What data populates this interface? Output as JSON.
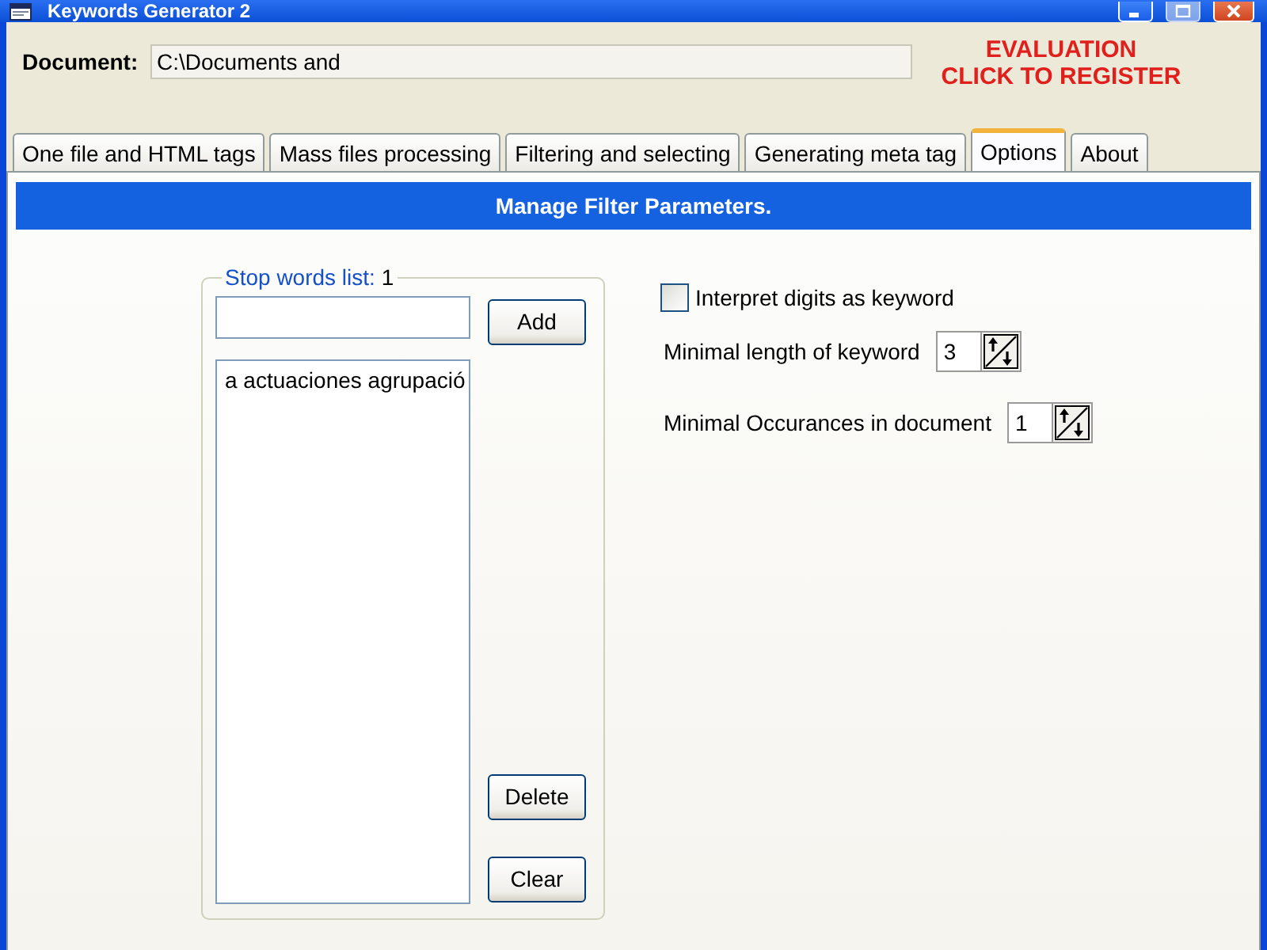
{
  "window": {
    "title": "Keywords Generator 2",
    "buttons": [
      {
        "kind": "minimize",
        "disabled": false
      },
      {
        "kind": "maximize",
        "disabled": true
      },
      {
        "kind": "close",
        "disabled": false
      }
    ]
  },
  "document": {
    "label": "Document:",
    "value": "C:\\Documents and"
  },
  "notice": {
    "status": "EVALUATION",
    "link": "CLICK TO REGISTER"
  },
  "tabs": [
    {
      "label": "One file and HTML tags",
      "selected": false
    },
    {
      "label": "Mass files processing",
      "selected": false
    },
    {
      "label": "Filtering and selecting",
      "selected": false
    },
    {
      "label": "Generating meta tag",
      "selected": false
    },
    {
      "label": "Options",
      "selected": true
    },
    {
      "label": "About",
      "selected": false
    }
  ],
  "panel_title": "Manage Filter Parameters.",
  "stop_words": {
    "label": "Stop words list:",
    "count": "1",
    "items": [
      "a actuaciones agrupació"
    ],
    "add_button": "Add",
    "delete_button": "Delete",
    "clear_button": "Clear"
  },
  "options": [
    {
      "kind": "checkbox",
      "label": "Interpret digits as keyword",
      "checked": false
    },
    {
      "kind": "spin",
      "label": "Minimal length of keyword",
      "value": "3"
    },
    {
      "kind": "spin",
      "label": "Minimal Occurances in document",
      "value": "1"
    }
  ]
}
